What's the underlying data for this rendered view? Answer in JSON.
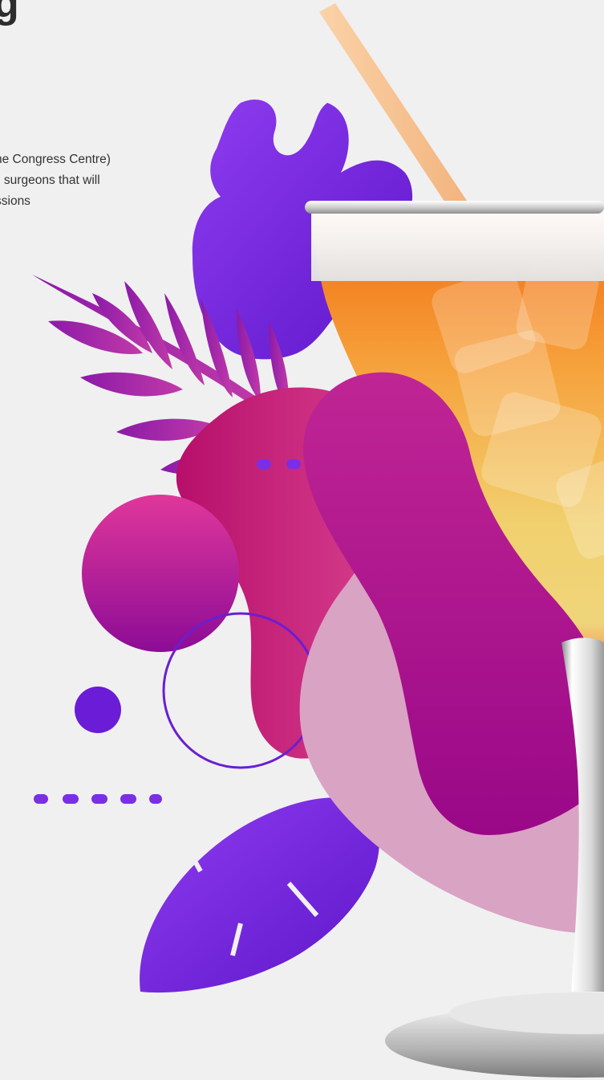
{
  "page": {
    "heading": "g",
    "lines": [
      "he Congress Centre)",
      "g surgeons that will",
      "ssions"
    ]
  },
  "theme": {
    "background": "#f0f0f1",
    "purple": "#7a2fe6",
    "magenta": "#c21f86",
    "pink": "#d9a3c4",
    "drink_orange": "#f4801c",
    "drink_yellow": "#f1d370"
  },
  "art": {
    "icons": [
      "monstera-leaf",
      "palm-leaf",
      "feather-leaf",
      "cocktail-glass",
      "straw",
      "ice-cubes",
      "dot-row",
      "circle",
      "ring"
    ]
  }
}
